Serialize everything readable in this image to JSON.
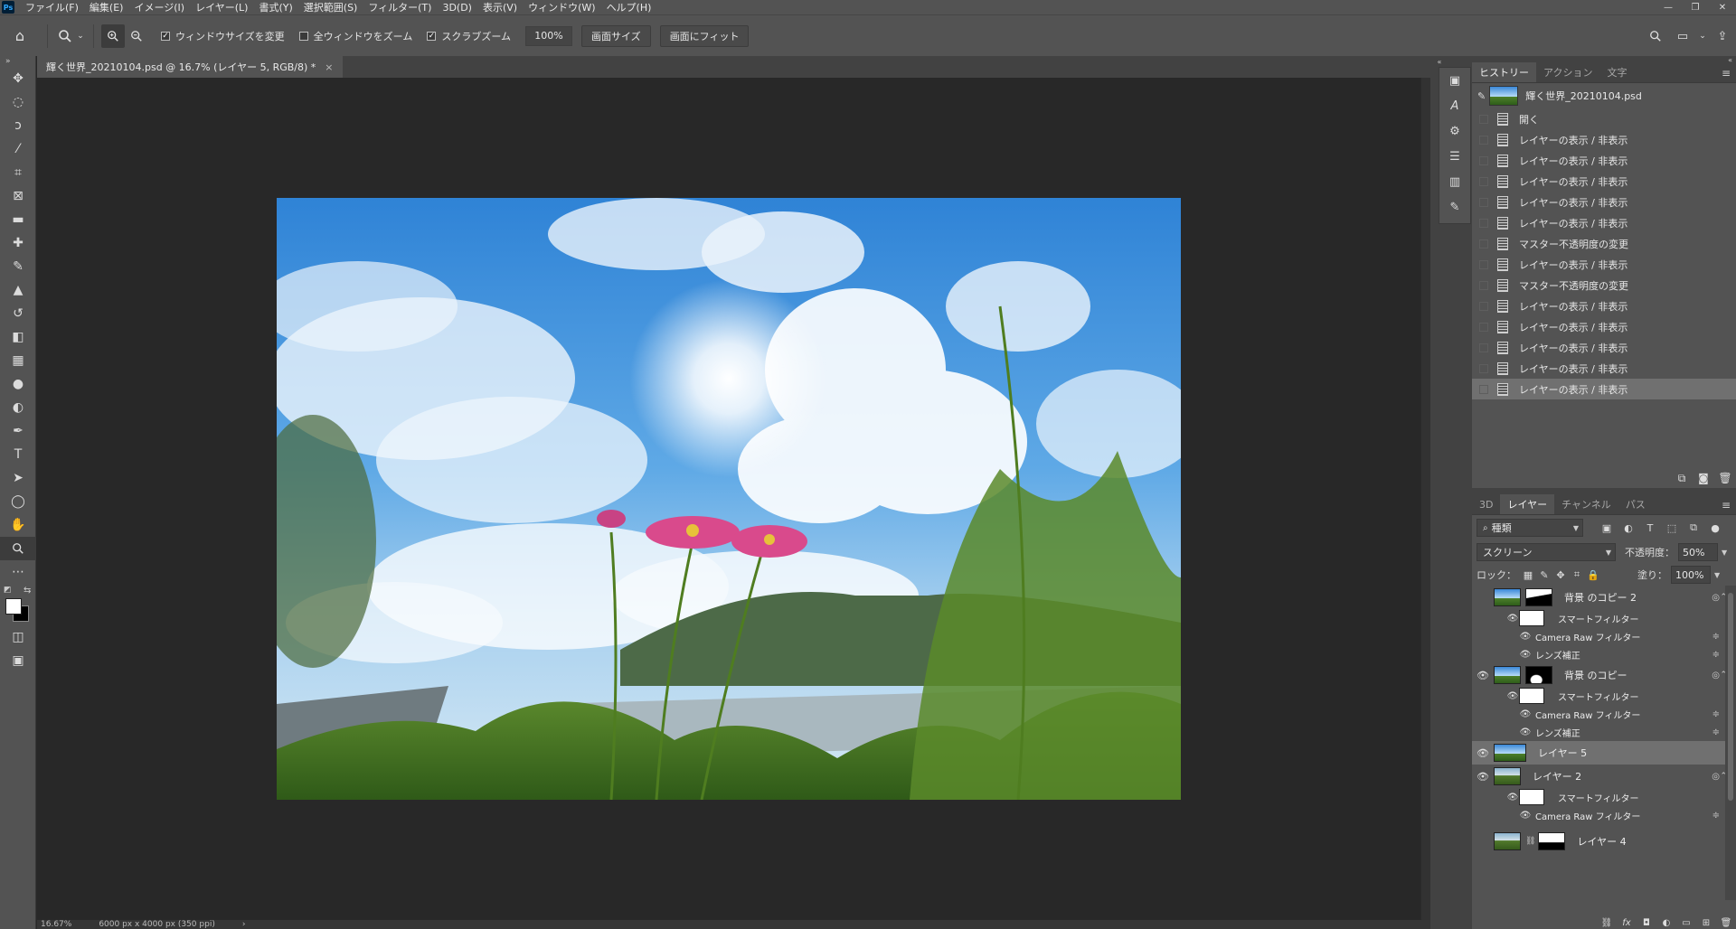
{
  "app": {
    "logo": "Ps"
  },
  "menu": [
    "ファイル(F)",
    "編集(E)",
    "イメージ(I)",
    "レイヤー(L)",
    "書式(Y)",
    "選択範囲(S)",
    "フィルター(T)",
    "3D(D)",
    "表示(V)",
    "ウィンドウ(W)",
    "ヘルプ(H)"
  ],
  "window_controls": {
    "minimize": "—",
    "restore": "❐",
    "close": "✕"
  },
  "options_bar": {
    "resize_windows": "ウィンドウサイズを変更",
    "zoom_all_windows": "全ウィンドウをズーム",
    "scrubby_zoom": "スクラブズーム",
    "zoom_value": "100%",
    "actual_size": "画面サイズ",
    "fit_screen": "画面にフィット"
  },
  "document": {
    "tab_title": "輝く世界_20210104.psd @ 16.7% (レイヤー 5, RGB/8) *",
    "close": "×"
  },
  "status": {
    "zoom": "16.67%",
    "doc_size": "6000 px x 4000 px (350 ppi)",
    "arrow": "›"
  },
  "history_panel": {
    "tabs": [
      "ヒストリー",
      "アクション",
      "文字"
    ],
    "snapshot_name": "輝く世界_20210104.psd",
    "items": [
      "開く",
      "レイヤーの表示 / 非表示",
      "レイヤーの表示 / 非表示",
      "レイヤーの表示 / 非表示",
      "レイヤーの表示 / 非表示",
      "レイヤーの表示 / 非表示",
      "マスター不透明度の変更",
      "レイヤーの表示 / 非表示",
      "マスター不透明度の変更",
      "レイヤーの表示 / 非表示",
      "レイヤーの表示 / 非表示",
      "レイヤーの表示 / 非表示",
      "レイヤーの表示 / 非表示",
      "レイヤーの表示 / 非表示"
    ]
  },
  "layers_panel": {
    "tabs": [
      "3D",
      "レイヤー",
      "チャンネル",
      "パス"
    ],
    "filter_kind": "種類",
    "blend_mode": "スクリーン",
    "opacity_label": "不透明度：",
    "opacity_value": "50%",
    "lock_label": "ロック：",
    "fill_label": "塗り：",
    "fill_value": "100%",
    "layers": {
      "bg_copy2": "背景 のコピー 2",
      "smart_filter_1": "スマートフィルター",
      "camera_raw_1": "Camera Raw フィルター",
      "lens_1": "レンズ補正",
      "bg_copy": "背景 のコピー",
      "smart_filter_2": "スマートフィルター",
      "camera_raw_2": "Camera Raw フィルター",
      "lens_2": "レンズ補正",
      "layer5": "レイヤー 5",
      "layer2": "レイヤー 2",
      "smart_filter_3": "スマートフィルター",
      "camera_raw_3": "Camera Raw フィルター",
      "layer4": "レイヤー 4"
    }
  },
  "colors": {
    "accent_selected": "#707070",
    "panel": "#535353",
    "canvas": "#282828",
    "foreground": "#ffffff",
    "background": "#000000"
  },
  "icons": {
    "tools": [
      "move-icon",
      "marquee-icon",
      "lasso-icon",
      "magic-wand-icon",
      "crop-icon",
      "frame-icon",
      "ruler-icon",
      "healing-icon",
      "brush-icon",
      "stamp-icon",
      "history-brush-icon",
      "eraser-icon",
      "gradient-icon",
      "blur-icon",
      "dodge-icon",
      "pen-icon",
      "type-icon",
      "path-select-icon",
      "ellipse-icon",
      "hand-icon",
      "zoom-icon",
      "more-tools-icon"
    ]
  }
}
